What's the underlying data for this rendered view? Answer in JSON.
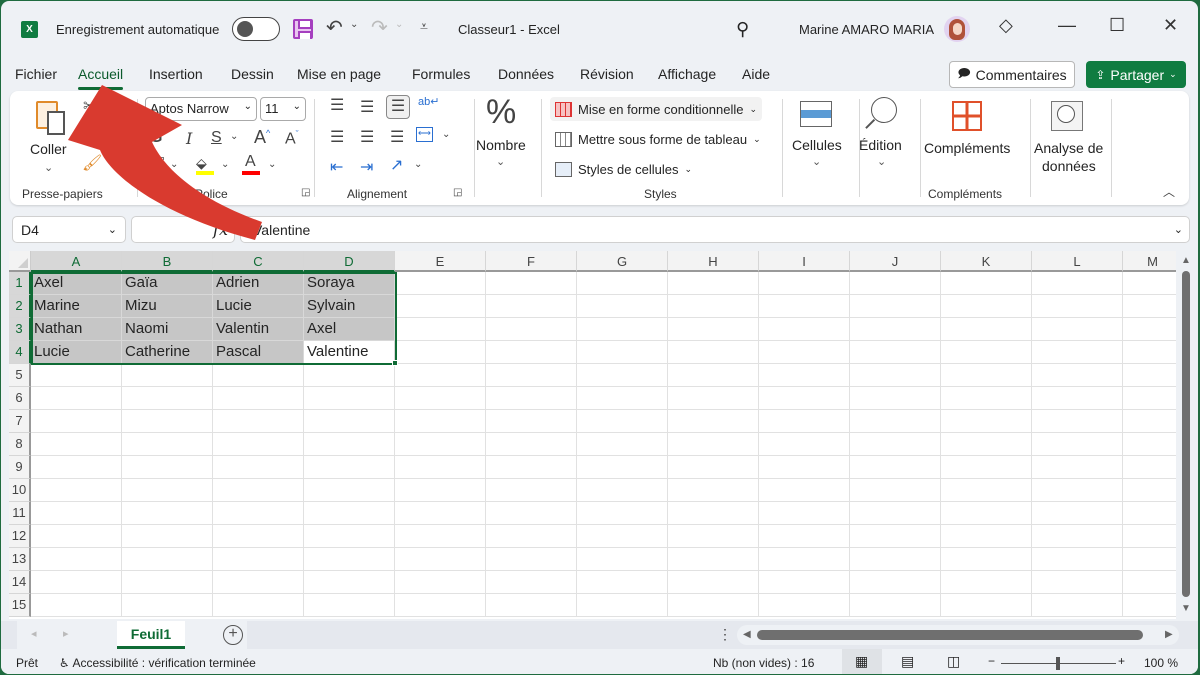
{
  "titlebar": {
    "app_logo": "X",
    "autosave_label": "Enregistrement automatique",
    "autosave_state": "off",
    "undo_icon": "↶",
    "redo_icon": "↷",
    "customize_icon": "⩡",
    "document_title": "Classeur1  -  Excel",
    "search_icon": "⚲",
    "user_name": "Marine AMARO MARIA",
    "premium_icon": "◇",
    "minimize_icon": "—",
    "maximize_icon": "☐",
    "close_icon": "✕"
  },
  "menu": {
    "items": [
      "Fichier",
      "Accueil",
      "Insertion",
      "Dessin",
      "Mise en page",
      "Formules",
      "Données",
      "Révision",
      "Affichage",
      "Aide"
    ],
    "active": "Accueil",
    "comments_label": "Commentaires",
    "share_label": "Partager"
  },
  "ribbon": {
    "clipboard": {
      "paste_label": "Coller",
      "group_label": "Presse-papiers"
    },
    "font": {
      "font_name": "Aptos Narrow",
      "font_size": "11",
      "bold": "G",
      "italic": "I",
      "underline": "S",
      "grow": "A",
      "shrink": "A",
      "fill_color": "#ffff00",
      "font_color": "#ff0000",
      "group_label": "Police"
    },
    "alignment": {
      "group_label": "Alignement",
      "wrap_icon": "ab↵"
    },
    "number": {
      "icon": "%",
      "label": "Nombre"
    },
    "styles": {
      "conditional": "Mise en forme conditionnelle",
      "table": "Mettre sous forme de tableau",
      "cell_styles": "Styles de cellules",
      "group_label": "Styles"
    },
    "cells_label": "Cellules",
    "edit_label": "Édition",
    "addins": {
      "button_label": "Compléments",
      "group_label": "Compléments"
    },
    "analyze_label_1": "Analyse de",
    "analyze_label_2": "données"
  },
  "formula_bar": {
    "name_box": "D4",
    "fx": "fx",
    "value": "Valentine"
  },
  "sheet": {
    "columns": [
      "A",
      "B",
      "C",
      "D",
      "E",
      "F",
      "G",
      "H",
      "I",
      "J",
      "K",
      "L",
      "M"
    ],
    "rows": [
      "1",
      "2",
      "3",
      "4",
      "5",
      "6",
      "7",
      "8",
      "9",
      "10",
      "11",
      "12",
      "13",
      "14",
      "15"
    ],
    "selected_range": "A1:D4",
    "active_cell": "D4",
    "cells": [
      [
        "Axel",
        "Gaïa",
        "Adrien",
        "Soraya"
      ],
      [
        "Marine",
        "Mizu",
        "Lucie",
        "Sylvain"
      ],
      [
        "Nathan",
        "Naomi",
        "Valentin",
        "Axel"
      ],
      [
        "Lucie",
        "Catherine",
        "Pascal",
        "Valentine"
      ]
    ]
  },
  "tabs": {
    "sheets": [
      "Feuil1"
    ],
    "active": "Feuil1",
    "add_icon": "+"
  },
  "status": {
    "ready": "Prêt",
    "accessibility": "Accessibilité : vérification terminée",
    "count": "Nb (non vides) : 16",
    "zoom_minus": "−",
    "zoom_plus": "+",
    "zoom_level": "100 %",
    "zoom_percent": 100
  },
  "annotation": {
    "arrow_color": "#d93a2f",
    "points_to": "Accueil"
  }
}
